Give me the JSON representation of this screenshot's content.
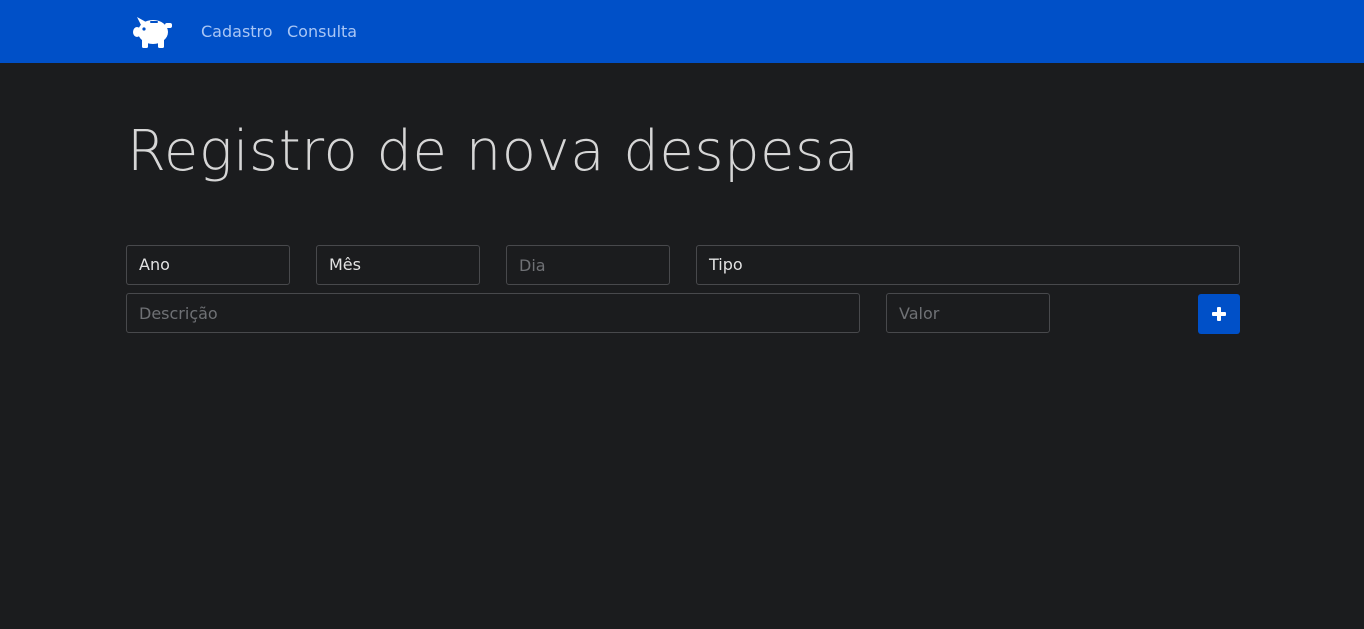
{
  "colors": {
    "navbar": "#0050c8",
    "background": "#1b1c1e",
    "nav_link": "#a9c6f5",
    "title": "#d6d6d6",
    "button": "#0050c8"
  },
  "navbar": {
    "logo_icon": "piggy-bank-icon",
    "links": [
      {
        "label": "Cadastro"
      },
      {
        "label": "Consulta"
      }
    ]
  },
  "main": {
    "title": "Registro de nova despesa",
    "form": {
      "ano": {
        "value": "Ano"
      },
      "mes": {
        "value": "Mês"
      },
      "dia": {
        "placeholder": "Dia",
        "value": ""
      },
      "tipo": {
        "value": "Tipo"
      },
      "descricao": {
        "placeholder": "Descrição",
        "value": ""
      },
      "valor": {
        "placeholder": "Valor",
        "value": ""
      },
      "submit_icon": "plus-icon"
    }
  }
}
